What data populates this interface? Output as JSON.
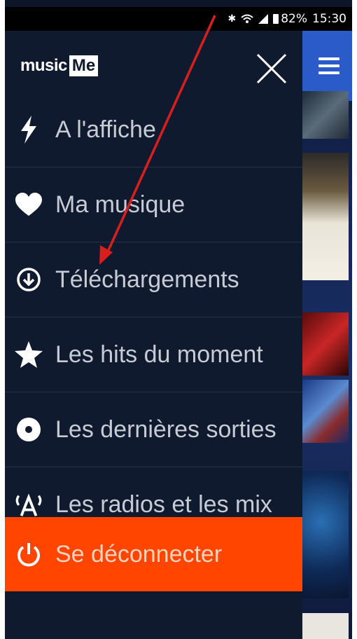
{
  "status": {
    "bluetooth_icon": "bluetooth-icon",
    "wifi_icon": "wifi-icon",
    "signal_icon": "signal-icon",
    "battery_pct": "82%",
    "time": "15:30"
  },
  "drawer": {
    "logo_text_1": "music",
    "logo_text_2": "Me",
    "items": [
      {
        "label": "A l'affiche",
        "icon": "lightning-icon"
      },
      {
        "label": "Ma musique",
        "icon": "heart-icon"
      },
      {
        "label": "Téléchargements",
        "icon": "download-circle-icon"
      },
      {
        "label": "Les hits du moment",
        "icon": "star-icon"
      },
      {
        "label": "Les dernières sorties",
        "icon": "disc-icon"
      },
      {
        "label": "Les radios et les mix",
        "icon": "radio-icon"
      }
    ],
    "logout_label": "Se déconnecter"
  },
  "colors": {
    "drawer_bg": "#0f1a2e",
    "logout_bg": "#ff4500",
    "header_bg": "#2a5bc9",
    "annotation_arrow": "#d91e1e"
  }
}
